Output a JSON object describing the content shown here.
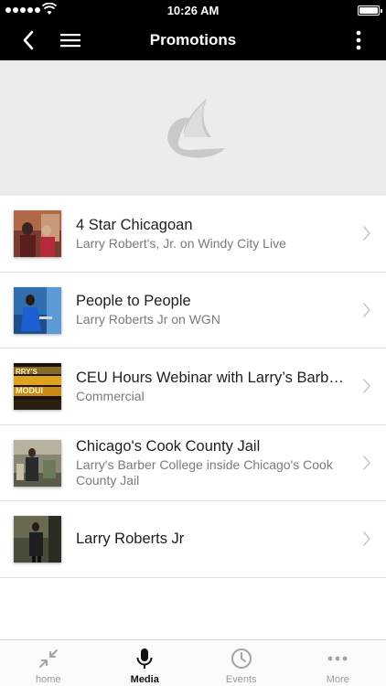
{
  "status_bar": {
    "time": "10:26 AM"
  },
  "nav": {
    "title": "Promotions",
    "back_icon": "chevron-left-icon",
    "menu_icon": "hamburger-menu-icon",
    "more_icon": "vertical-dots-icon"
  },
  "banner": {
    "logo_icon": "app-logo-icon"
  },
  "items": [
    {
      "title": "4 Star Chicagoan",
      "subtitle": "Larry Robert's, Jr. on Windy City Live"
    },
    {
      "title": "People to People",
      "subtitle": "Larry Roberts Jr on WGN"
    },
    {
      "title": "CEU Hours Webinar with Larry’s Barber College",
      "subtitle": "Commercial"
    },
    {
      "title": "Chicago's Cook County Jail",
      "subtitle": "Larry's Barber College inside Chicago's Cook County Jail"
    },
    {
      "title": "Larry Roberts Jr",
      "subtitle": ""
    }
  ],
  "tabs": [
    {
      "label": "home",
      "icon": "collapse-arrows-icon",
      "active": false
    },
    {
      "label": "Media",
      "icon": "microphone-icon",
      "active": true
    },
    {
      "label": "Events",
      "icon": "clock-icon",
      "active": false
    },
    {
      "label": "More",
      "icon": "horizontal-dots-icon",
      "active": false
    }
  ],
  "colors": {
    "nav_background": "#000000",
    "banner_background": "#ececec",
    "active_tab": "#111111",
    "inactive_tab": "#999999"
  }
}
